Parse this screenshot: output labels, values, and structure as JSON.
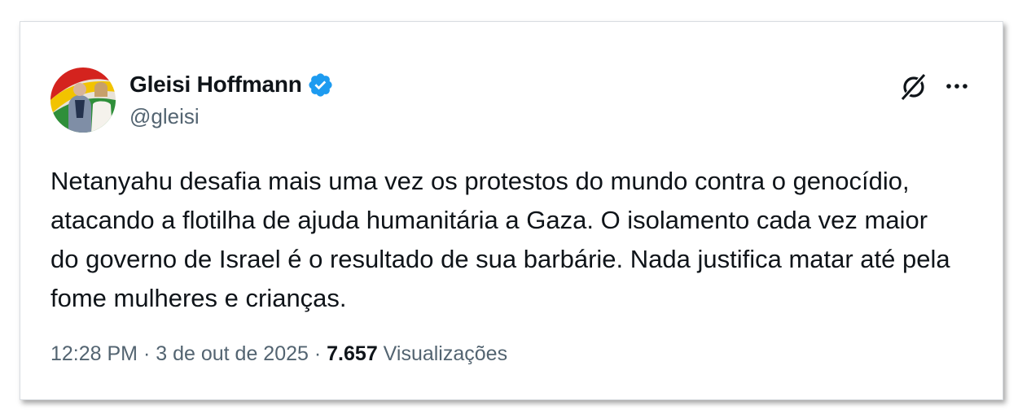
{
  "tweet": {
    "author": {
      "display_name": "Gleisi Hoffmann",
      "handle": "@gleisi",
      "verified": true,
      "verified_color": "#1d9bf0"
    },
    "text": "Netanyahu desafia mais uma vez os protestos do mundo contra o genocídio, atacando a flotilha de ajuda humanitária a Gaza. O isolamento cada vez maior do governo de Israel é o resultado de sua barbárie. Nada justifica matar até pela fome mulheres e crianças.",
    "time": "12:28 PM",
    "separator": "·",
    "date": "3 de out de 2025",
    "views_count": "7.657",
    "views_label": "Visualizações"
  },
  "icons": {
    "grok": "grok-icon",
    "more": "more-options-icon",
    "verified": "verified-badge-icon"
  }
}
